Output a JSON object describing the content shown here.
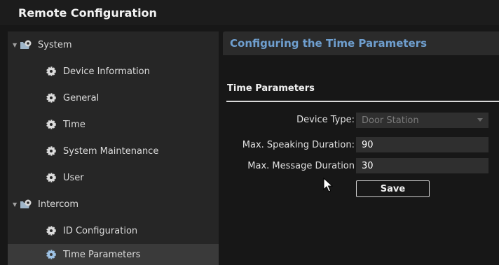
{
  "window": {
    "title": "Remote Configuration"
  },
  "sidebar": {
    "items": [
      {
        "label": "System",
        "level": 0,
        "expanded": true,
        "icon": "folder-gear-icon"
      },
      {
        "label": "Device Information",
        "level": 1,
        "icon": "gear-icon"
      },
      {
        "label": "General",
        "level": 1,
        "icon": "gear-icon"
      },
      {
        "label": "Time",
        "level": 1,
        "icon": "gear-icon"
      },
      {
        "label": "System Maintenance",
        "level": 1,
        "icon": "gear-icon"
      },
      {
        "label": "User",
        "level": 1,
        "icon": "gear-icon"
      },
      {
        "label": "Intercom",
        "level": 0,
        "expanded": true,
        "icon": "folder-gear-icon"
      },
      {
        "label": "ID Configuration",
        "level": 1,
        "icon": "gear-icon"
      },
      {
        "label": "Time Parameters",
        "level": 1,
        "icon": "gear-icon",
        "selected": true
      }
    ]
  },
  "content": {
    "header": "Configuring the Time Parameters",
    "section_title": "Time Parameters",
    "fields": {
      "device_type": {
        "label": "Device Type:",
        "value": "Door Station"
      },
      "max_speaking": {
        "label": "Max. Speaking Duration:",
        "value": "90"
      },
      "max_message": {
        "label": "Max. Message Duration",
        "value": "30"
      }
    },
    "save_label": "Save"
  },
  "colors": {
    "accent": "#6f9fcf",
    "background": "#171717",
    "sidebar": "#262626",
    "selected": "#3a3a3a"
  }
}
